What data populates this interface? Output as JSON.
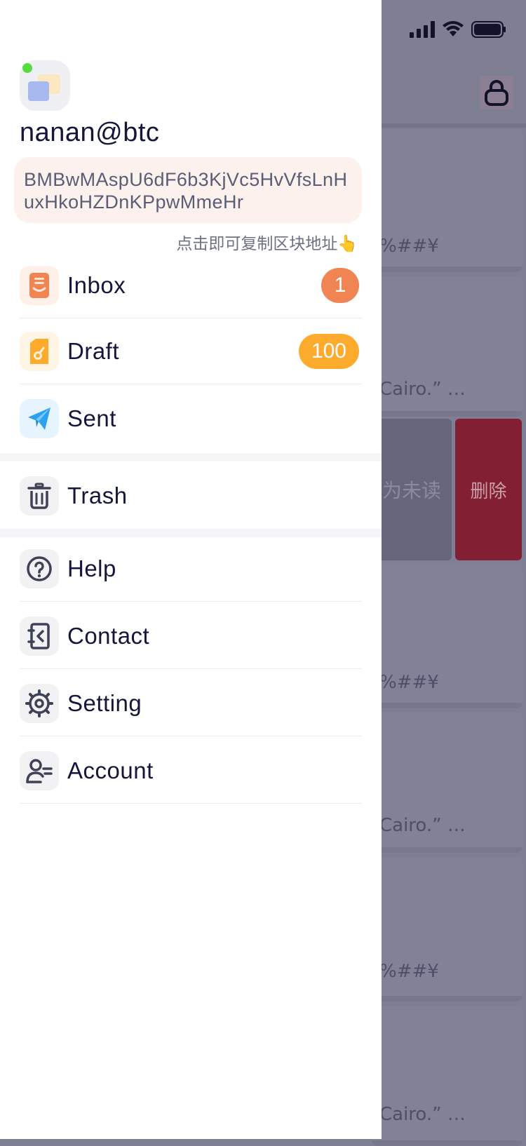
{
  "background": {
    "snippets": [
      "%##¥",
      "Cairo.” …",
      "%##¥",
      "Cairo.” …",
      "%##¥",
      "Cairo.” …"
    ],
    "swipe_actions": {
      "mark_unread_label": "为未读",
      "delete_label": "删除"
    },
    "lock_icon": "lock-icon"
  },
  "drawer": {
    "username": "nanan@btc",
    "address": "BMBwMAspU6dF6b3KjVc5HvVfsLnHuxHkoHZDnKPpwMmeHr",
    "copy_hint": "点击即可复制区块地址👆",
    "menu": [
      {
        "label": "Inbox",
        "icon": "inbox-icon",
        "badge": "1",
        "badge_color": "#f08452"
      },
      {
        "label": "Draft",
        "icon": "draft-icon",
        "badge": "100",
        "badge_color": "#fdab2d"
      },
      {
        "label": "Sent",
        "icon": "sent-icon"
      },
      {
        "label": "Trash",
        "icon": "trash-icon"
      },
      {
        "label": "Help",
        "icon": "help-icon"
      },
      {
        "label": "Contact",
        "icon": "contact-icon"
      },
      {
        "label": "Setting",
        "icon": "gear-icon"
      },
      {
        "label": "Account",
        "icon": "account-icon"
      }
    ]
  },
  "colors": {
    "accent_orange": "#f08452",
    "accent_yellow": "#fdab2d",
    "sent_blue": "#2aa1f3",
    "delete_red": "#821f33",
    "text_dark": "#15173a"
  }
}
